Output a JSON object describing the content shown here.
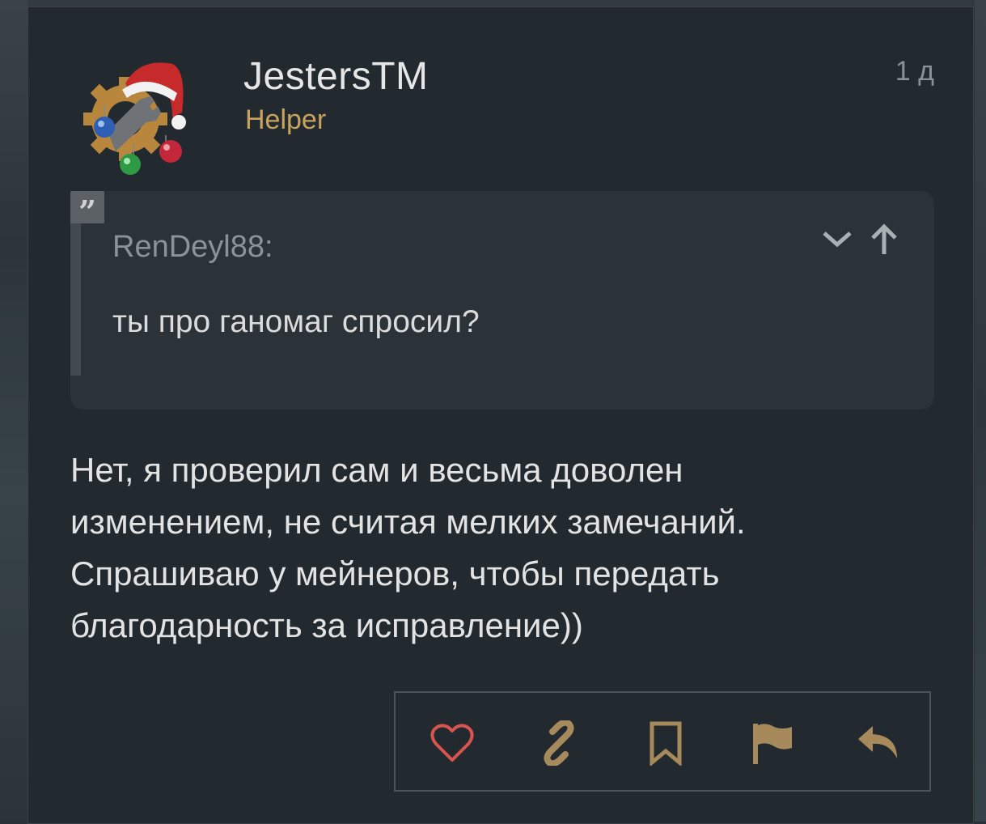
{
  "post": {
    "author": "JestersTM",
    "author_title": "Helper",
    "date": "1 д",
    "quote": {
      "author": "RenDeyl88:",
      "text": "ты про ганомаг спросил?",
      "quote_mark": "”"
    },
    "body_lines": [
      "Нет, я проверил сам и весьма доволен",
      "изменением, не считая мелких замечаний.",
      "Спрашиваю у мейнеров, чтобы передать",
      "благодарность за исправление))"
    ],
    "actions": [
      {
        "name": "like",
        "icon": "heart-icon",
        "color": "#d9534f"
      },
      {
        "name": "share-link",
        "icon": "link-icon",
        "color": "#a68a5c"
      },
      {
        "name": "bookmark",
        "icon": "bookmark-icon",
        "color": "#a68a5c"
      },
      {
        "name": "report",
        "icon": "flag-icon",
        "color": "#a68a5c"
      },
      {
        "name": "reply",
        "icon": "reply-icon",
        "color": "#a68a5c"
      }
    ]
  },
  "colors": {
    "accent": "#c9a35e",
    "like": "#d9534f",
    "action": "#a68a5c"
  }
}
